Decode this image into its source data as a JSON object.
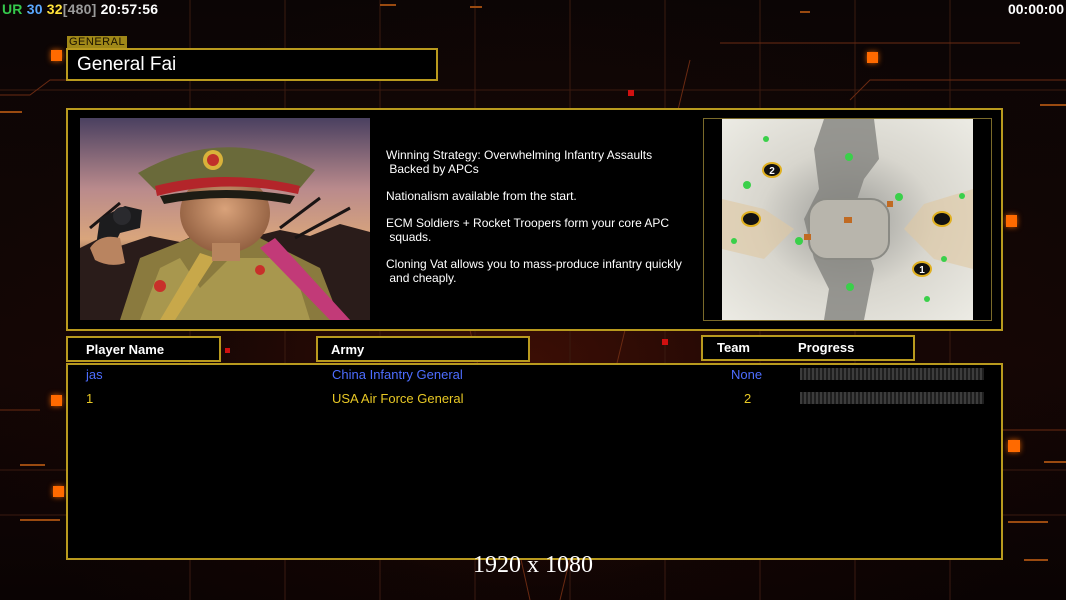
{
  "hud": {
    "ur": "UR",
    "fps_a": "30",
    "fps_b": "32",
    "frame": "[480]",
    "clock": "20:57:56",
    "game_time": "00:00:00"
  },
  "general": {
    "tag": "GENERAL",
    "name": "General Fai",
    "description": [
      "Winning Strategy: Overwhelming Infantry Assaults\n Backed by APCs",
      "Nationalism available from the start.",
      "ECM Soldiers + Rocket Troopers form your core APC\n squads.",
      "Cloning Vat allows you to mass-produce infantry quickly\n and cheaply."
    ]
  },
  "map": {
    "start_positions": [
      "2",
      "1"
    ]
  },
  "table": {
    "headers": {
      "player_name": "Player Name",
      "army": "Army",
      "team": "Team",
      "progress": "Progress"
    },
    "rows": [
      {
        "player": "jas",
        "army": "China Infantry General",
        "team": "None",
        "color": "#4d6dff"
      },
      {
        "player": "1",
        "army": "USA Air Force General",
        "team": "2",
        "color": "#e8c825"
      }
    ]
  },
  "overlay": {
    "resolution": "1920 x 1080"
  }
}
